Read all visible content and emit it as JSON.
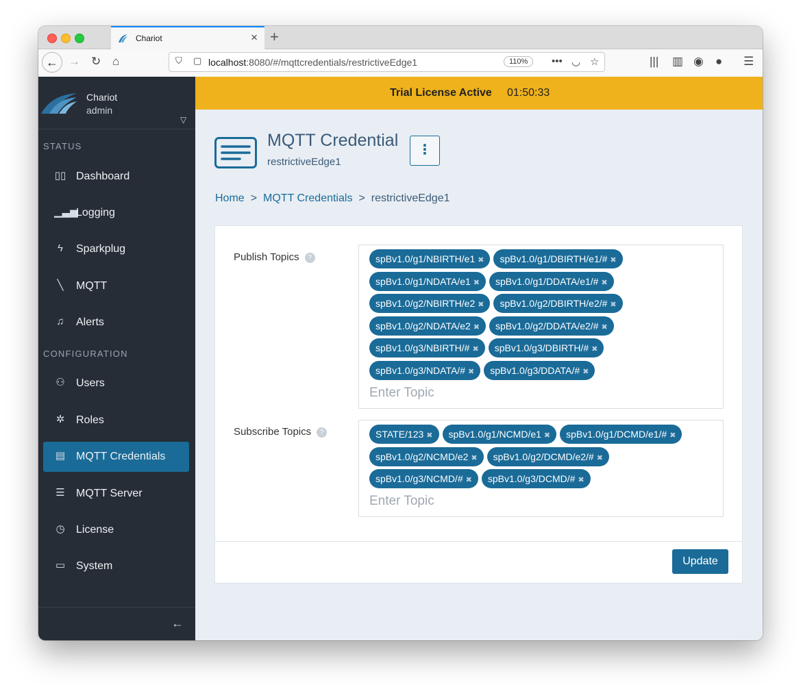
{
  "browser": {
    "tab_title": "Chariot",
    "url_host": "localhost",
    "url_path": ":8080/#/mqttcredentials/restrictiveEdge1",
    "zoom": "110%"
  },
  "sidebar": {
    "user_name": "Chariot",
    "user_role": "admin",
    "sections": [
      "STATUS",
      "CONFIGURATION"
    ],
    "items": [
      {
        "label": "Dashboard",
        "icon": "dashboard-icon"
      },
      {
        "label": "Logging",
        "icon": "bar-chart-icon"
      },
      {
        "label": "Sparkplug",
        "icon": "bolt-icon"
      },
      {
        "label": "MQTT",
        "icon": "mqtt-line-icon"
      },
      {
        "label": "Alerts",
        "icon": "bell-icon"
      },
      {
        "label": "Users",
        "icon": "users-icon"
      },
      {
        "label": "Roles",
        "icon": "roles-icon"
      },
      {
        "label": "MQTT Credentials",
        "icon": "credentials-icon",
        "active": true
      },
      {
        "label": "MQTT Server",
        "icon": "database-icon"
      },
      {
        "label": "License",
        "icon": "stopwatch-icon"
      },
      {
        "label": "System",
        "icon": "laptop-icon"
      }
    ]
  },
  "banner": {
    "title": "Trial License Active",
    "time": "01:50:33"
  },
  "page": {
    "title": "MQTT Credential",
    "subtitle": "restrictiveEdge1",
    "breadcrumb": [
      "Home",
      "MQTT Credentials",
      "restrictiveEdge1"
    ],
    "breadcrumb_sep": ">"
  },
  "form": {
    "publish_label": "Publish Topics",
    "subscribe_label": "Subscribe Topics",
    "help_glyph": "?",
    "topic_placeholder": "Enter Topic",
    "publish_topics": [
      "spBv1.0/g1/NBIRTH/e1",
      "spBv1.0/g1/DBIRTH/e1/#",
      "spBv1.0/g1/NDATA/e1",
      "spBv1.0/g1/DDATA/e1/#",
      "spBv1.0/g2/NBIRTH/e2",
      "spBv1.0/g2/DBIRTH/e2/#",
      "spBv1.0/g2/NDATA/e2",
      "spBv1.0/g2/DDATA/e2/#",
      "spBv1.0/g3/NBIRTH/#",
      "spBv1.0/g3/DBIRTH/#",
      "spBv1.0/g3/NDATA/#",
      "spBv1.0/g3/DDATA/#"
    ],
    "subscribe_topics": [
      "STATE/123",
      "spBv1.0/g1/NCMD/e1",
      "spBv1.0/g1/DCMD/e1/#",
      "spBv1.0/g2/NCMD/e2",
      "spBv1.0/g2/DCMD/e2/#",
      "spBv1.0/g3/NCMD/#",
      "spBv1.0/g3/DCMD/#"
    ],
    "update_label": "Update"
  },
  "colors": {
    "accent": "#1a6b98",
    "banner": "#efb21c",
    "sidebar": "#262d36"
  }
}
